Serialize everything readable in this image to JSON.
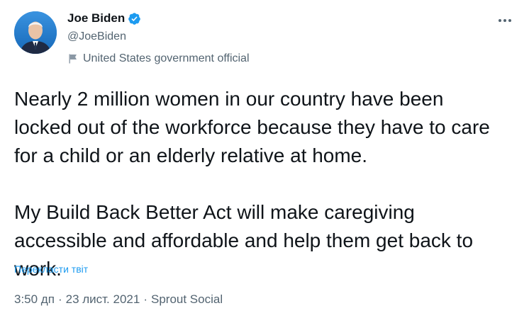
{
  "author": {
    "name": "Joe Biden",
    "handle": "@JoeBiden",
    "verified": true,
    "label": "United States government official",
    "label_icon": "flag-icon",
    "avatar_icon": "avatar"
  },
  "more_icon": "more-horizontal-icon",
  "tweet": {
    "text": "Nearly 2 million women in our country have been\nlocked out of the workforce because they have to care\nfor a child or an elderly relative at home.\n\nMy Build Back Better Act will make caregiving\naccessible and affordable and help them get back to\nwork.",
    "translate_label": "Перекласти твіт"
  },
  "meta": {
    "time": "3:50 дп",
    "separator": "·",
    "date": "23 лист. 2021",
    "source": "Sprout Social"
  },
  "colors": {
    "accent": "#1d9bf0",
    "text": "#0f1419",
    "secondary": "#536471"
  }
}
